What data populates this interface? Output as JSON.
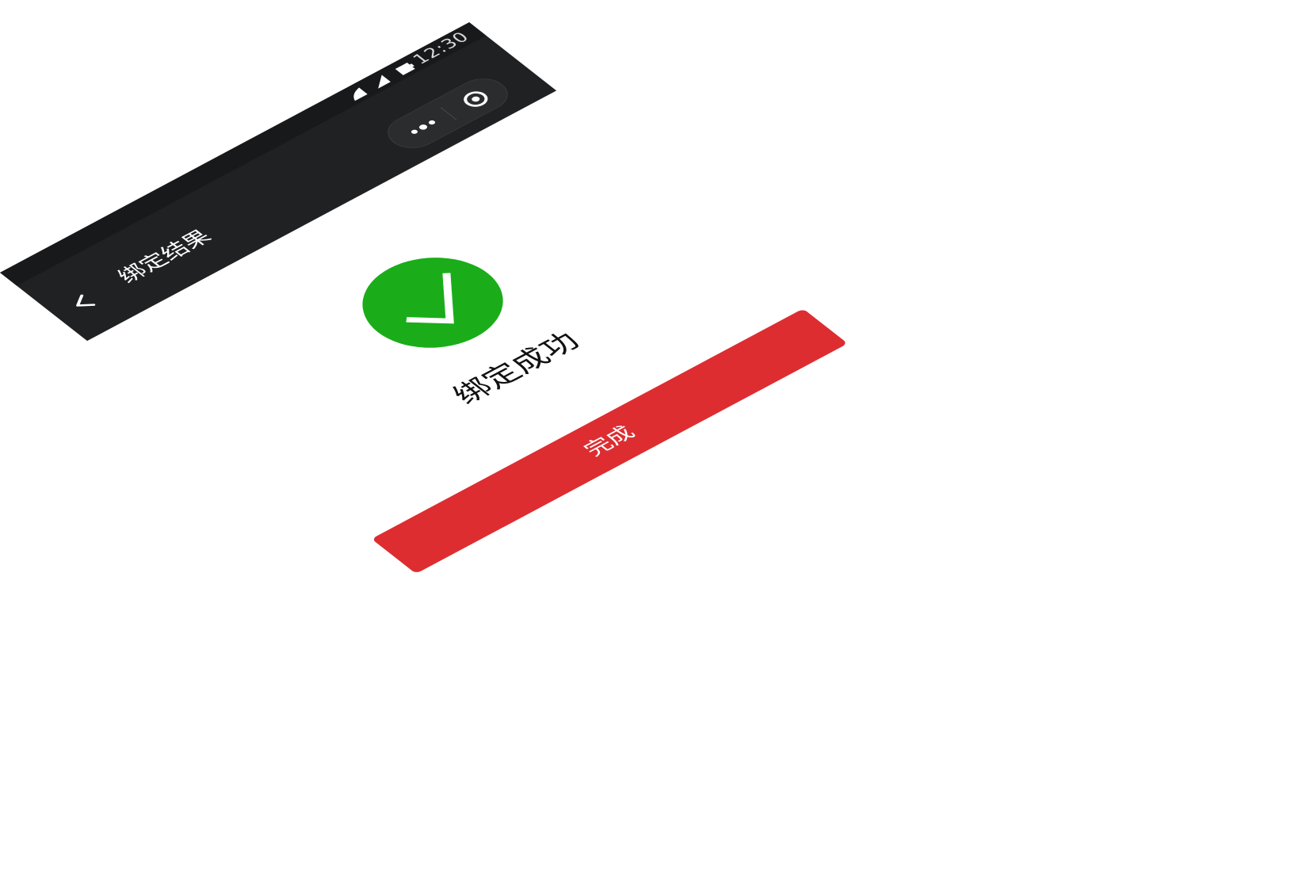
{
  "status_bar": {
    "time": "12:30",
    "icons": [
      "signal-icon",
      "wifi-icon",
      "battery-icon"
    ]
  },
  "nav_bar": {
    "back_icon": "back-arrow-icon",
    "title": "绑定结果",
    "capsule_icons": [
      "more-icon",
      "close-mini-icon"
    ]
  },
  "result": {
    "icon": "check-icon",
    "message": "绑定成功"
  },
  "actions": {
    "done_label": "完成"
  },
  "colors": {
    "top_bar": "#1f2123",
    "success": "#1aad19",
    "primary_button": "#dd2d31"
  }
}
